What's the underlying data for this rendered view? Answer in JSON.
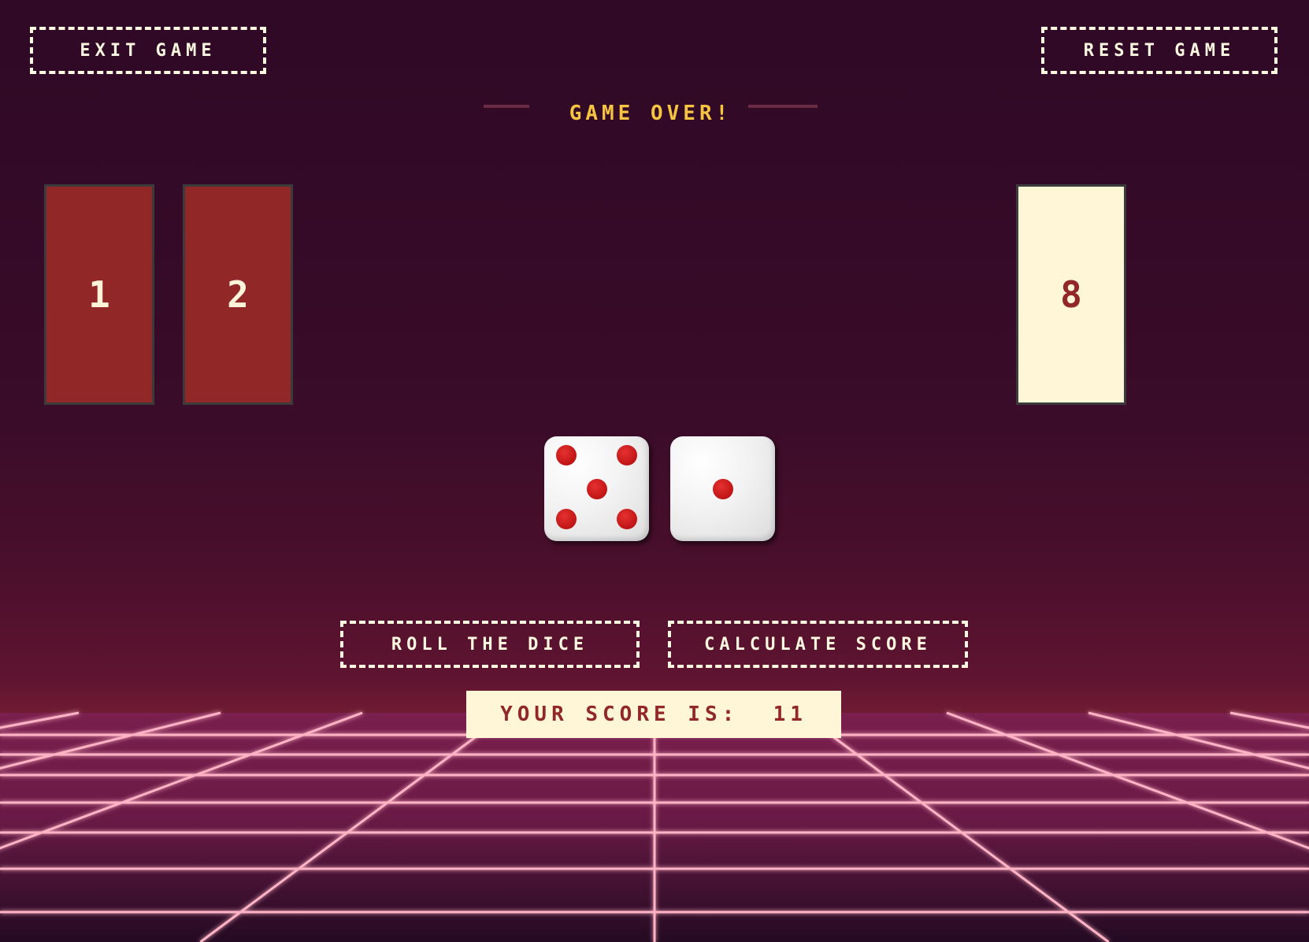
{
  "header": {
    "exit_label": "EXIT GAME",
    "reset_label": "RESET GAME"
  },
  "status": {
    "message": "GAME OVER!"
  },
  "cards": [
    {
      "number": "1",
      "state": "shut"
    },
    {
      "number": "2",
      "state": "shut"
    },
    {
      "number": "8",
      "state": "open"
    }
  ],
  "dice": [
    {
      "value": 5
    },
    {
      "value": 1
    }
  ],
  "controls": {
    "roll_label": "ROLL THE DICE",
    "calc_label": "CALCULATE SCORE"
  },
  "score": {
    "label": "YOUR SCORE IS:",
    "value": "11"
  },
  "colors": {
    "card_shut": "#922728",
    "card_open": "#fff6d8",
    "status_text": "#f5c542",
    "grid_line": "#ff8fa8"
  }
}
